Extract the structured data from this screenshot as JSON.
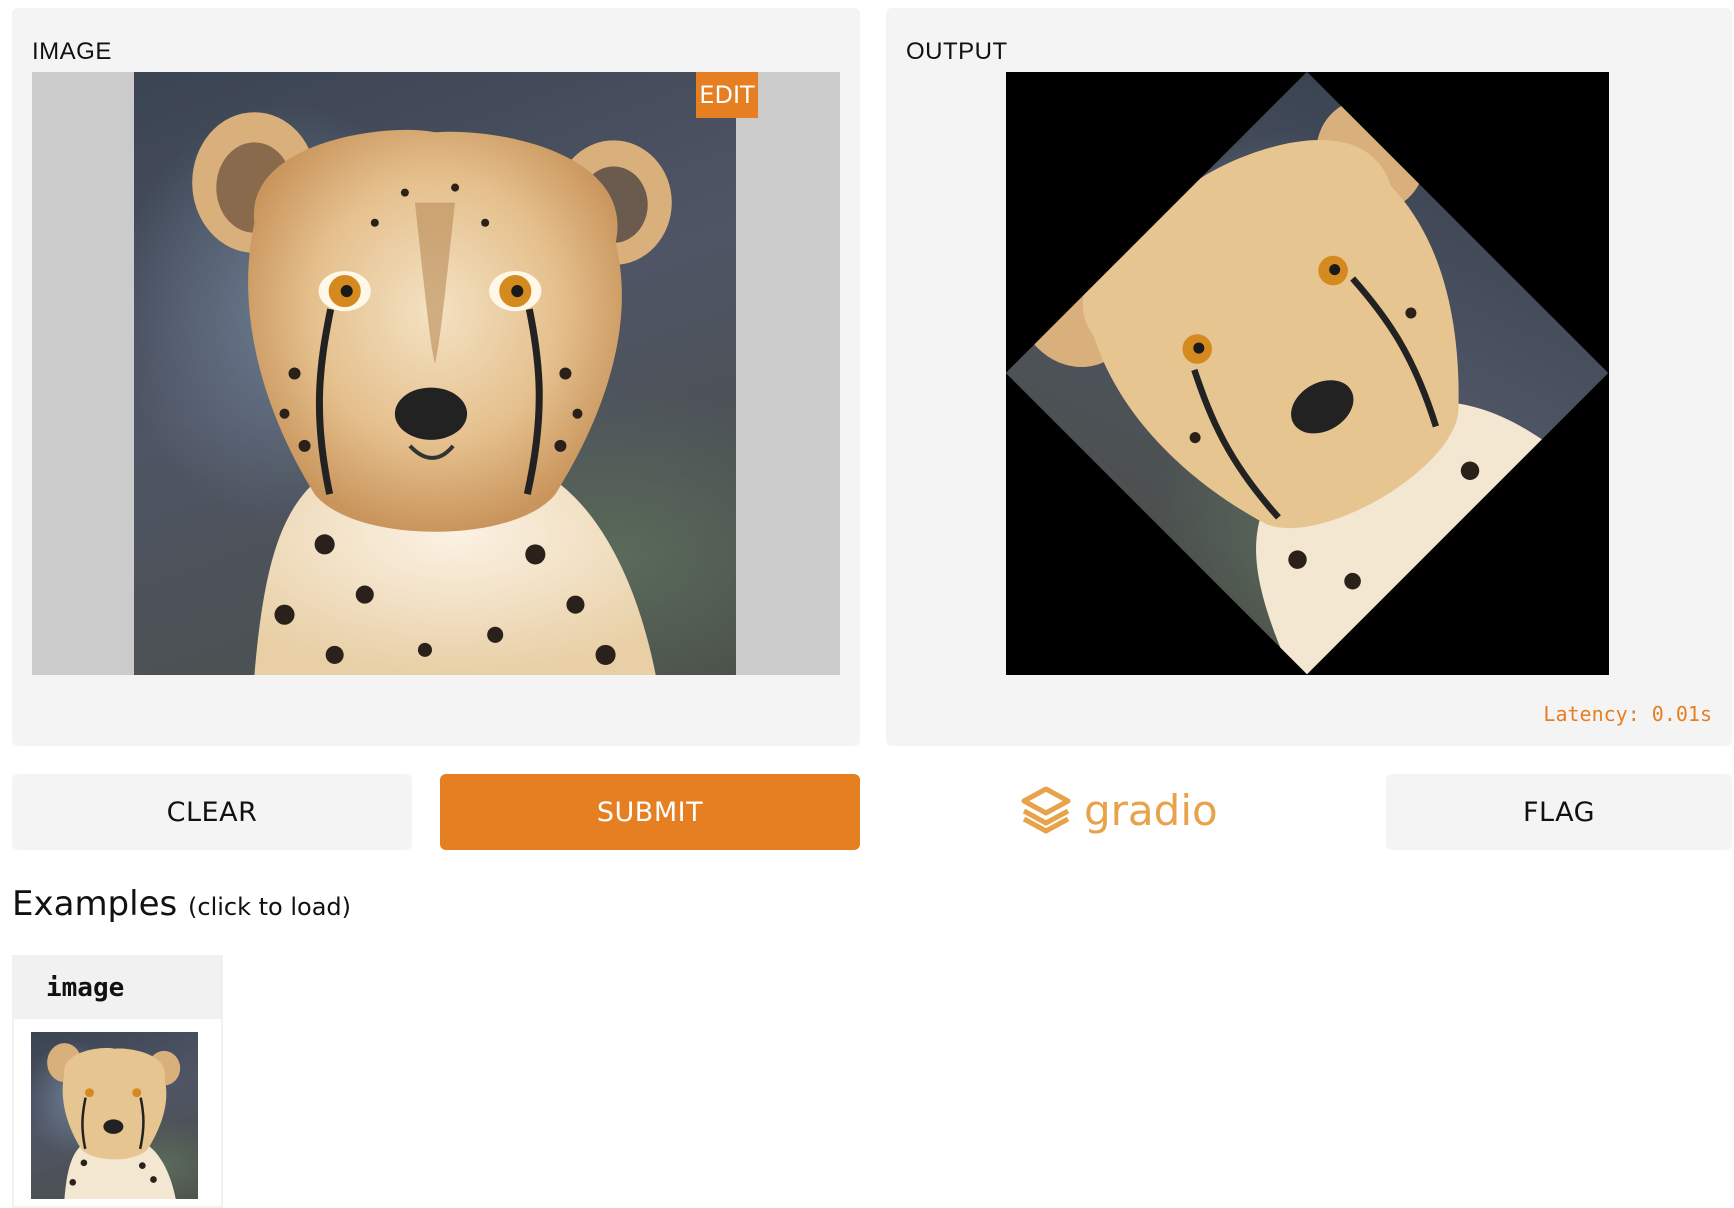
{
  "input_panel": {
    "label": "IMAGE",
    "edit_label": "EDIT"
  },
  "output_panel": {
    "label": "OUTPUT",
    "latency": "Latency: 0.01s"
  },
  "actions": {
    "clear_label": "CLEAR",
    "submit_label": "SUBMIT",
    "flag_label": "FLAG"
  },
  "brand": {
    "name": "gradio",
    "icon": "gradio-logo-icon"
  },
  "examples": {
    "title": "Examples",
    "subtitle": "(click to load)",
    "column_header": "image"
  },
  "colors": {
    "accent": "#e67e22",
    "panel_bg": "#f4f4f4",
    "letterbox": "#cbcbcb"
  }
}
